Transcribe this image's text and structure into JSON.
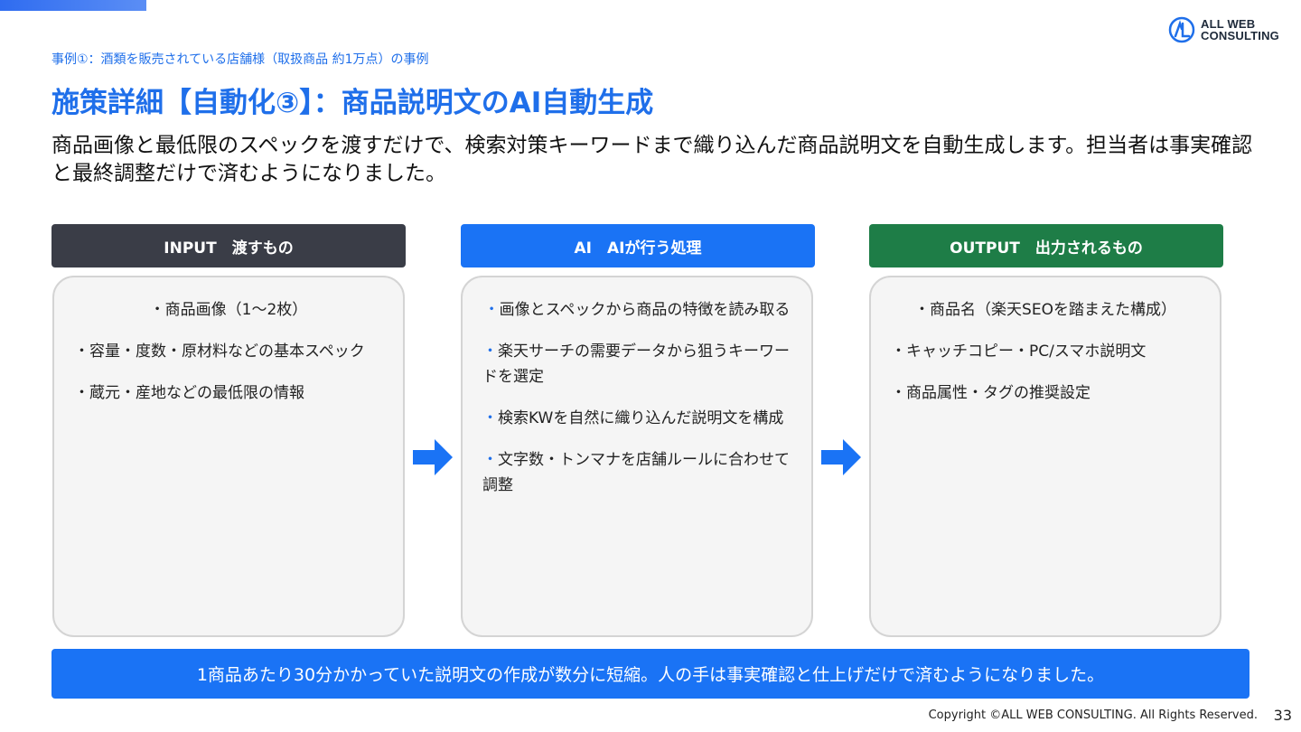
{
  "brand": {
    "logo_line1": "ALL WEB",
    "logo_line2": "CONSULTING",
    "accent": "#1f6fea"
  },
  "header": {
    "case_label": "事例①：酒類を販売されている店舗様（取扱商品 約1万点）の事例",
    "title": "施策詳細【自動化③】：商品説明文のAI自動生成",
    "lead": "商品画像と最低限のスペックを渡すだけで、検索対策キーワードまで織り込んだ商品説明文を自動生成します。担当者は事実確認と最終調整だけで済むようになりました。"
  },
  "columns": [
    {
      "header": "INPUT　渡すもの",
      "color": "#3a3d47",
      "items": [
        "・商品画像（1～2枚）",
        "・容量・度数・原材料などの基本スペック",
        "・蔵元・産地などの最低限の情報"
      ]
    },
    {
      "header": "AI　AIが行う処理",
      "color": "#1a73f5",
      "items": [
        "画像とスペックから商品の特徴を読み取る",
        "楽天サーチの需要データから狙うキーワードを選定",
        "検索KWを自然に織り込んだ説明文を構成",
        "文字数・トンマナを店舗ルールに合わせて調整"
      ]
    },
    {
      "header": "OUTPUT　出力されるもの",
      "color": "#1e7d47",
      "items": [
        "・商品名（楽天SEOを踏まえた構成）",
        "・キャッチコピー・PC/スマホ説明文",
        "・商品属性・タグの推奨設定"
      ]
    }
  ],
  "summary": "1商品あたり30分かかっていた説明文の作成が数分に短縮。人の手は事実確認と仕上げだけで済むようになりました。",
  "footer": {
    "copyright": "Copyright ©ALL WEB CONSULTING. All Rights Reserved.",
    "page_number": "33"
  }
}
